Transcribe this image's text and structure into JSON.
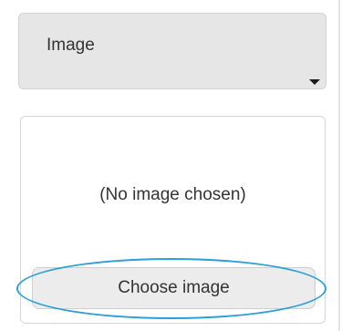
{
  "image_type_select": {
    "selected_value": "Image",
    "icon": "caret-down-icon"
  },
  "image_panel": {
    "status_text": "(No image chosen)",
    "choose_button_label": "Choose image"
  },
  "highlight": {
    "shape": "ellipse",
    "color": "#2a9fdc"
  }
}
